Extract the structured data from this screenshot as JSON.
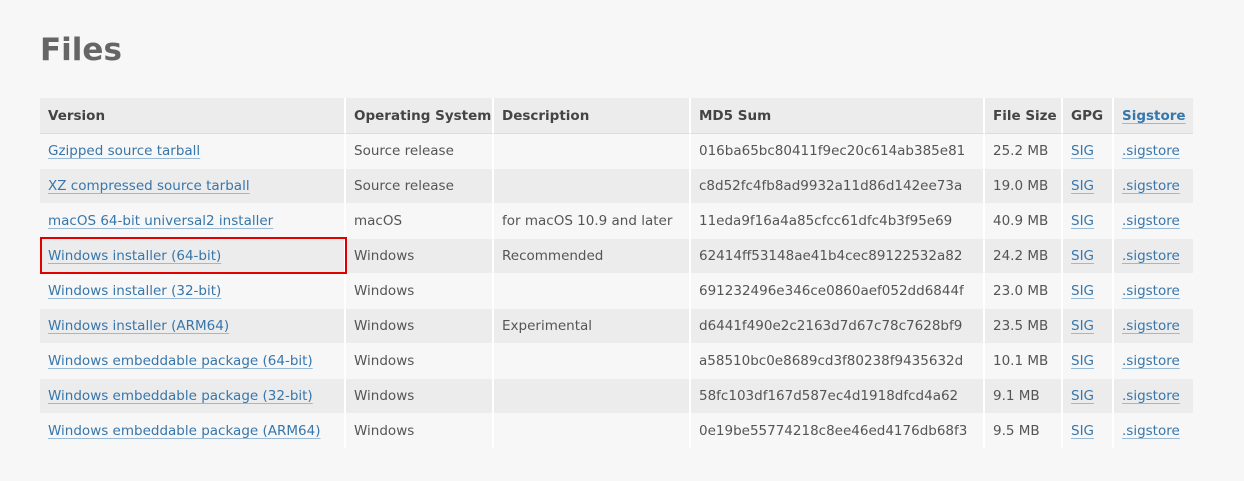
{
  "page": {
    "title": "Files"
  },
  "table": {
    "headers": {
      "version": "Version",
      "os": "Operating System",
      "description": "Description",
      "md5": "MD5 Sum",
      "size": "File Size",
      "gpg": "GPG",
      "sigstore": "Sigstore"
    },
    "rows": [
      {
        "version": "Gzipped source tarball",
        "os": "Source release",
        "description": "",
        "md5": "016ba65bc80411f9ec20c614ab385e81",
        "size": "25.2 MB",
        "gpg": "SIG",
        "sigstore": ".sigstore"
      },
      {
        "version": "XZ compressed source tarball",
        "os": "Source release",
        "description": "",
        "md5": "c8d52fc4fb8ad9932a11d86d142ee73a",
        "size": "19.0 MB",
        "gpg": "SIG",
        "sigstore": ".sigstore"
      },
      {
        "version": "macOS 64-bit universal2 installer",
        "os": "macOS",
        "description": "for macOS 10.9 and later",
        "md5": "11eda9f16a4a85cfcc61dfc4b3f95e69",
        "size": "40.9 MB",
        "gpg": "SIG",
        "sigstore": ".sigstore"
      },
      {
        "version": "Windows installer (64-bit)",
        "os": "Windows",
        "description": "Recommended",
        "md5": "62414ff53148ae41b4cec89122532a82",
        "size": "24.2 MB",
        "gpg": "SIG",
        "sigstore": ".sigstore"
      },
      {
        "version": "Windows installer (32-bit)",
        "os": "Windows",
        "description": "",
        "md5": "691232496e346ce0860aef052dd6844f",
        "size": "23.0 MB",
        "gpg": "SIG",
        "sigstore": ".sigstore"
      },
      {
        "version": "Windows installer (ARM64)",
        "os": "Windows",
        "description": "Experimental",
        "md5": "d6441f490e2c2163d7d67c78c7628bf9",
        "size": "23.5 MB",
        "gpg": "SIG",
        "sigstore": ".sigstore"
      },
      {
        "version": "Windows embeddable package (64-bit)",
        "os": "Windows",
        "description": "",
        "md5": "a58510bc0e8689cd3f80238f9435632d",
        "size": "10.1 MB",
        "gpg": "SIG",
        "sigstore": ".sigstore"
      },
      {
        "version": "Windows embeddable package (32-bit)",
        "os": "Windows",
        "description": "",
        "md5": "58fc103df167d587ec4d1918dfcd4a62",
        "size": "9.1 MB",
        "gpg": "SIG",
        "sigstore": ".sigstore"
      },
      {
        "version": "Windows embeddable package (ARM64)",
        "os": "Windows",
        "description": "",
        "md5": "0e19be55774218c8ee46ed4176db68f3",
        "size": "9.5 MB",
        "gpg": "SIG",
        "sigstore": ".sigstore"
      }
    ]
  },
  "colors": {
    "link": "#3776ab",
    "highlight": "#e00000",
    "header_bg": "#ececec",
    "page_bg": "#f7f7f7"
  }
}
